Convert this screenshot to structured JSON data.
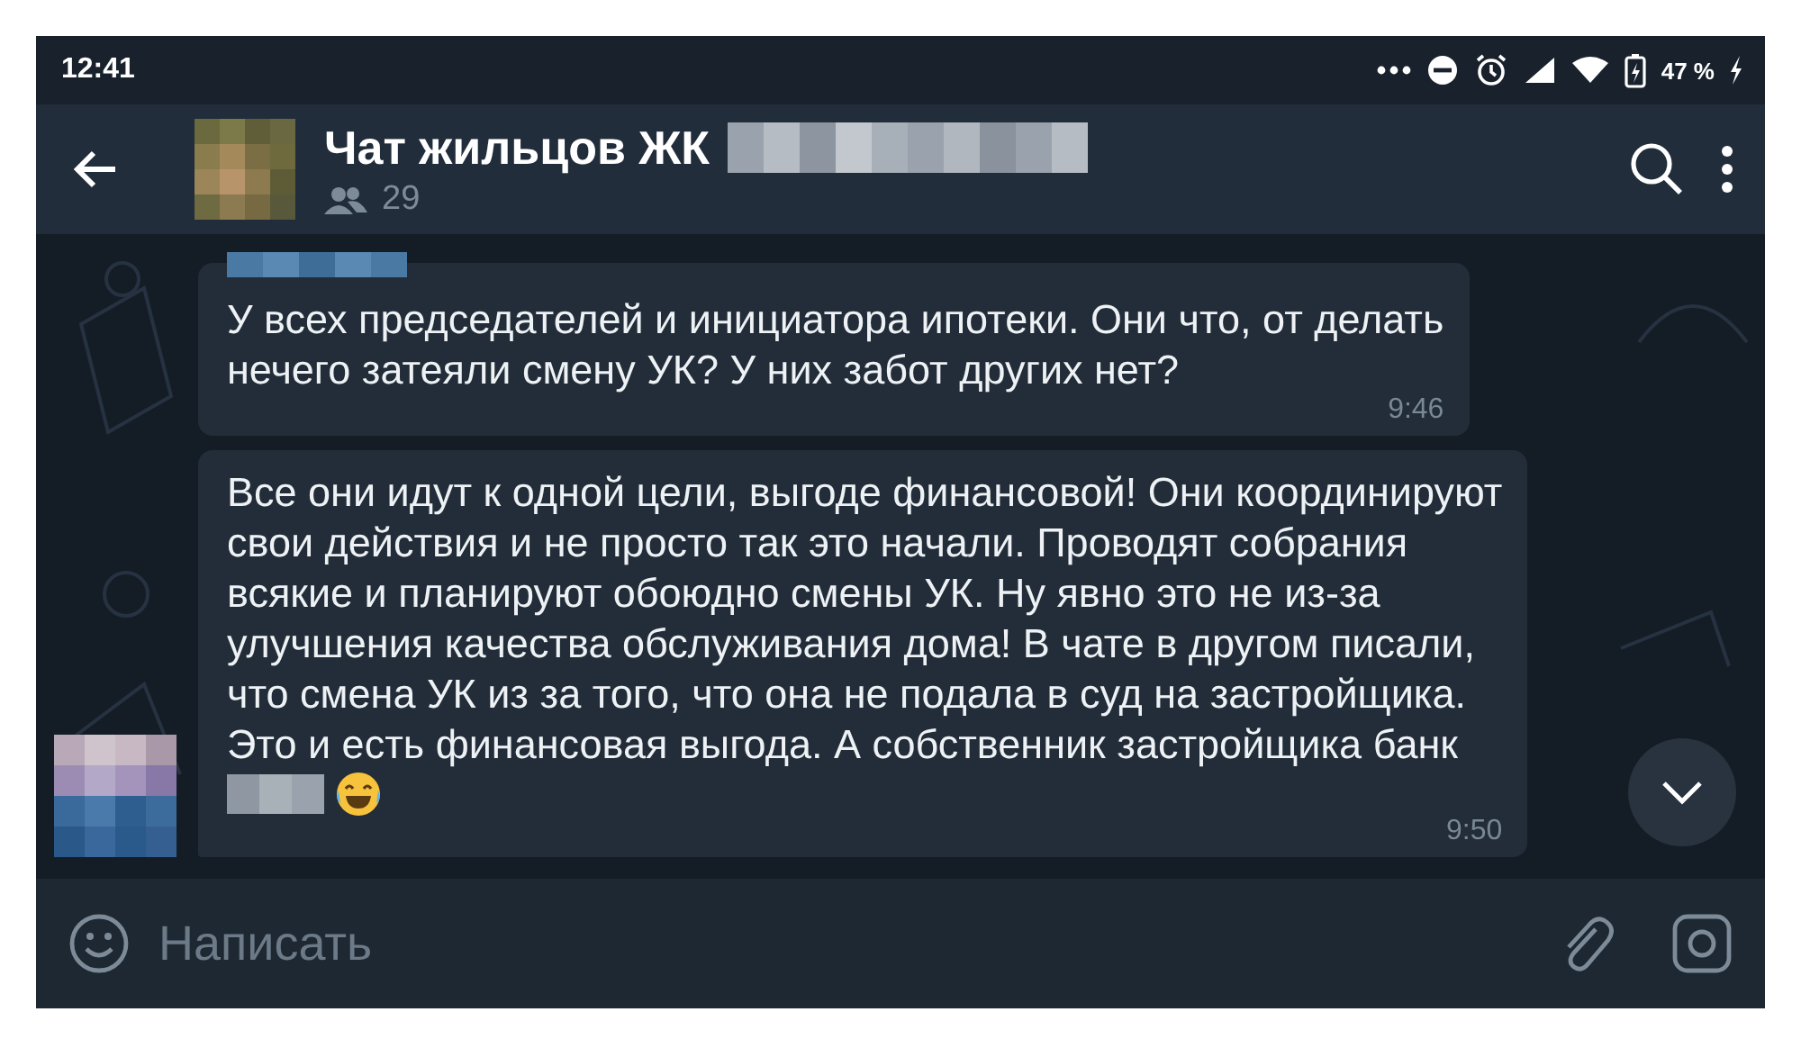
{
  "status_bar": {
    "time": "12:41",
    "battery": "47 %"
  },
  "header": {
    "title": "Чат жильцов ЖК",
    "members": "29"
  },
  "messages": [
    {
      "text": "У всех председателей и инициатора ипотеки. Они что, от делать\nнечего затеяли смену УК? У них забот других нет?",
      "time": "9:46",
      "avatar": false,
      "tail": false
    },
    {
      "text": "Все они идут к одной цели, выгоде финансовой! Они координируют\nсвои действия и не просто так это начали. Проводят собрания\nвсякие и планируют обоюдно смены УК. Ну явно это не из-за\nулучшения качества обслуживания дома! В чате в другом писали,\nчто смена УК из за того, что она не подала в суд на застройщика.\nЭто и есть финансовая выгода. А собственник застройщика банк",
      "time": "9:50",
      "avatar": true,
      "tail": true
    }
  ],
  "composer": {
    "placeholder": "Написать"
  }
}
